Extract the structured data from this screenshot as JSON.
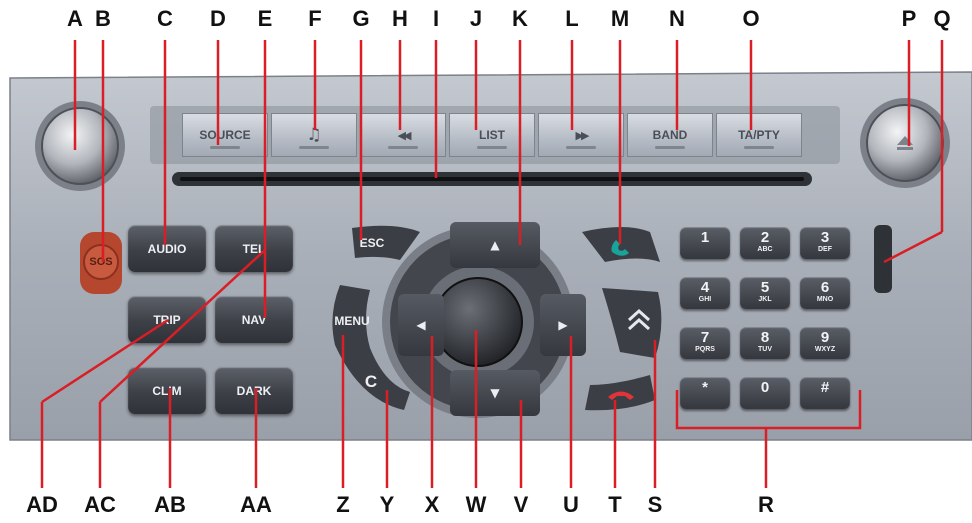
{
  "buttons": {
    "source": "SOURCE",
    "list": "LIST",
    "band": "BAND",
    "ta_pty": "TA/PTY",
    "audio": "AUDIO",
    "tel": "TEL",
    "trip": "TRIP",
    "nav": "NAV",
    "clim": "CLIM",
    "dark": "DARK",
    "esc": "ESC",
    "menu": "MENU",
    "c": "C",
    "sos": "SOS"
  },
  "icons": {
    "music_note": "music-note-icon",
    "rewind": "rewind-icon",
    "fast_forward": "fast-forward-icon",
    "eject": "eject-icon",
    "call_accept": "call-accept-icon",
    "call_end": "call-end-icon",
    "citroen_chevrons": "double-chevron-icon",
    "arrows": [
      "arrow-up-icon",
      "arrow-down-icon",
      "arrow-left-icon",
      "arrow-right-icon"
    ]
  },
  "keypad": [
    {
      "digit": "1",
      "letters": ""
    },
    {
      "digit": "2",
      "letters": "ABC"
    },
    {
      "digit": "3",
      "letters": "DEF"
    },
    {
      "digit": "4",
      "letters": "GHI"
    },
    {
      "digit": "5",
      "letters": "JKL"
    },
    {
      "digit": "6",
      "letters": "MNO"
    },
    {
      "digit": "7",
      "letters": "PQRS"
    },
    {
      "digit": "8",
      "letters": "TUV"
    },
    {
      "digit": "9",
      "letters": "WXYZ"
    },
    {
      "digit": "*",
      "letters": ""
    },
    {
      "digit": "0",
      "letters": ""
    },
    {
      "digit": "#",
      "letters": ""
    }
  ],
  "callouts": {
    "A": "A",
    "B": "B",
    "C": "C",
    "D": "D",
    "E": "E",
    "F": "F",
    "G": "G",
    "H": "H",
    "I": "I",
    "J": "J",
    "K": "K",
    "L": "L",
    "M": "M",
    "N": "N",
    "O": "O",
    "P": "P",
    "Q": "Q",
    "R": "R",
    "S": "S",
    "T": "T",
    "U": "U",
    "V": "V",
    "W": "W",
    "X": "X",
    "Y": "Y",
    "Z": "Z",
    "AA": "AA",
    "AB": "AB",
    "AC": "AC",
    "AD": "AD"
  },
  "colors": {
    "panel": "#a9afb8",
    "button": "#3d4047",
    "leader_line": "#d91e26",
    "sos": "#b5472f",
    "call_accept": "#1aa39a",
    "call_end": "#e0343a"
  }
}
